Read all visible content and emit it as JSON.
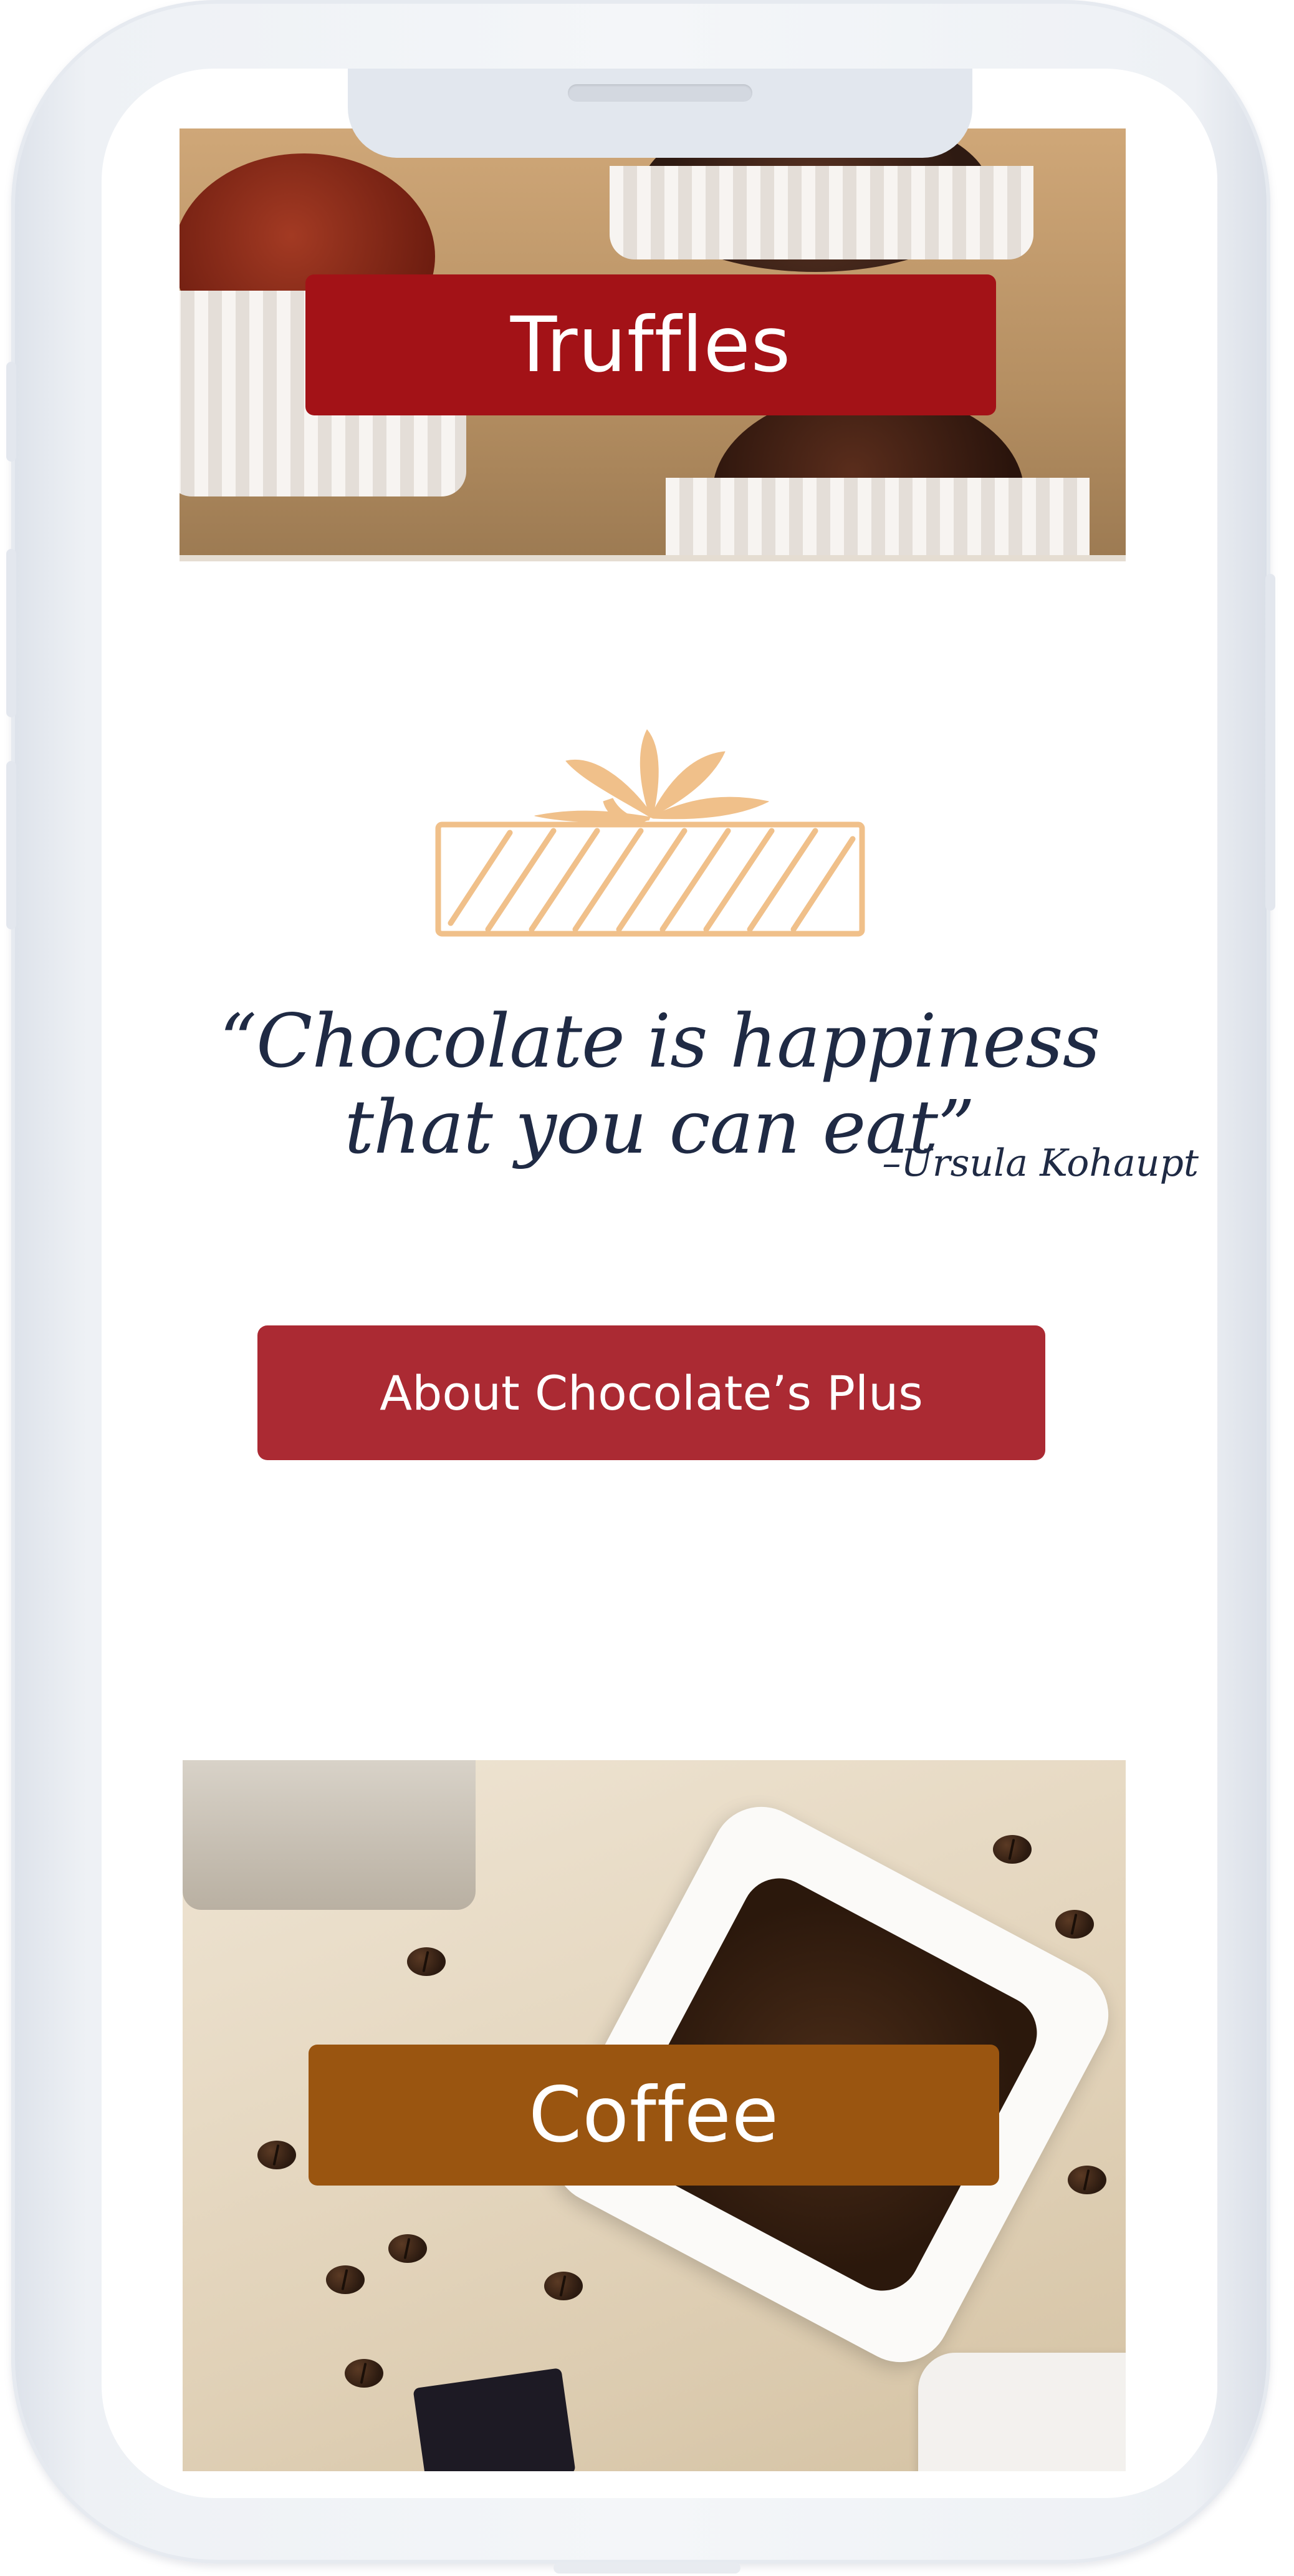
{
  "sections": {
    "truffles": {
      "banner_label": "Truffles"
    },
    "quote": {
      "text": "“Chocolate is happiness that you can eat”",
      "author": "–Ursula Kohaupt"
    },
    "about_button": {
      "label": "About Chocolate’s Plus"
    },
    "coffee": {
      "banner_label": "Coffee"
    }
  },
  "icons": {
    "gift": "gift-box-icon"
  },
  "colors": {
    "truffles_banner": "#a31217",
    "about_button": "#ab2a33",
    "coffee_banner": "#9a5510",
    "gift_icon": "#f0c08a",
    "quote_text": "#1f2a44"
  }
}
